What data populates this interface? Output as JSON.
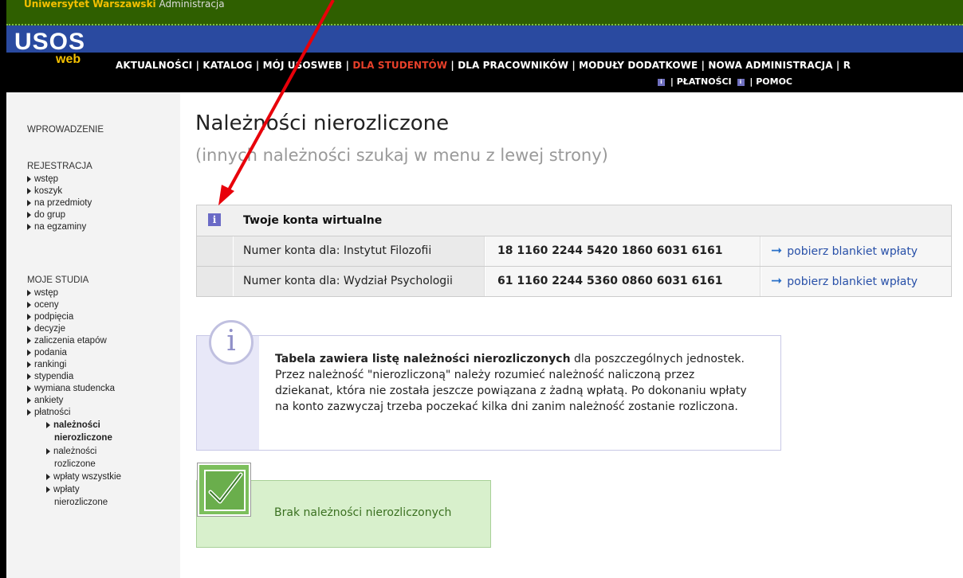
{
  "topbar": {
    "university": "Uniwersytet Warszawski",
    "section": "Administracja"
  },
  "logo": {
    "usos": "USOS",
    "web": "web"
  },
  "menu": {
    "aktualnosci": "AKTUALNOŚCI",
    "katalog": "KATALOG",
    "moj": "MÓJ USOSWEB",
    "dla_studentow": "DLA STUDENTÓW",
    "dla_pracownikow": "DLA PRACOWNIKÓW",
    "moduly": "MODUŁY DODATKOWE",
    "nowa_admin": "NOWA ADMINISTRACJA",
    "r": "R",
    "platnosci": "PŁATNOŚCI",
    "pomoc": "POMOC",
    "separator": "|",
    "info_icon": "i"
  },
  "sidebar": {
    "wprowadzenie": "WPROWADZENIE",
    "rejestracja": "REJESTRACJA",
    "rejestracja_items": [
      "wstęp",
      "koszyk",
      "na przedmioty",
      "do grup",
      "na egzaminy"
    ],
    "moje_studia": "MOJE STUDIA",
    "studia_items": [
      "wstęp",
      "oceny",
      "podpięcia",
      "decyzje",
      "zaliczenia etapów",
      "podania",
      "rankingi",
      "stypendia",
      "wymiana studencka",
      "ankiety",
      "płatności"
    ],
    "sub_active_1": "należności",
    "sub_active_2": "nierozliczone",
    "sub2_1": "należności",
    "sub2_2": "rozliczone",
    "sub3": "wpłaty wszystkie",
    "sub4_1": "wpłaty",
    "sub4_2": "nierozliczone"
  },
  "page": {
    "title": "Należności nierozliczone",
    "subtitle": "(innych należności szukaj w menu z lewej strony)"
  },
  "accounts": {
    "icon": "i",
    "title": "Twoje konta wirtualne",
    "rows": [
      {
        "label": "Numer konta dla: Instytut Filozofii",
        "number": "18 1160 2244 5420 1860 6031 6161",
        "action": "pobierz blankiet wpłaty"
      },
      {
        "label": "Numer konta dla: Wydział Psychologii",
        "number": "61 1160 2244 5360 0860 6031 6161",
        "action": "pobierz blankiet wpłaty"
      }
    ]
  },
  "info": {
    "icon": "i",
    "bold": "Tabela zawiera listę należności nierozliczonych",
    "text": " dla poszczególnych jednostek. Przez należność \"nierozliczoną\" należy rozumieć należność naliczoną przez dziekanat, która nie została jeszcze powiązana z żadną wpłatą. Po dokonaniu wpłaty na konto zazwyczaj trzeba poczekać kilka dni zanim należność zostanie rozliczona."
  },
  "ok": {
    "text": "Brak należności nierozliczonych"
  },
  "colors": {
    "active_menu": "#e8402a",
    "link": "#2850a8",
    "annotation_arrow": "#e8000a"
  }
}
